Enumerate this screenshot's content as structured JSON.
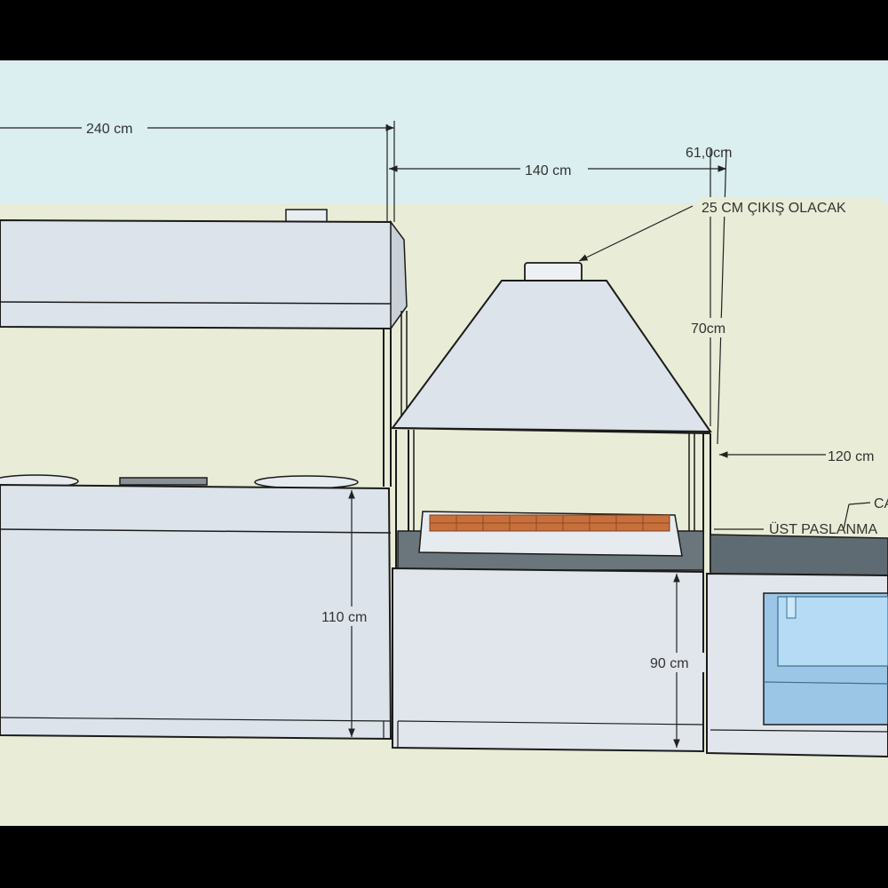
{
  "dimensions": {
    "hood_width": "240 cm",
    "grill_width": "140 cm",
    "gap": "61,0cm",
    "chimney_note": "25 CM ÇIKIŞ OLACAK",
    "hood_height": "70cm",
    "sink_width": "120 cm",
    "counter_note_1": "CA",
    "counter_note_2": "ÜST PASLANMA",
    "stove_height": "110 cm",
    "grill_height": "90 cm"
  },
  "colors": {
    "sky": "#dbeef0",
    "ground": "#e9ecd6",
    "panel": "#dde3ea",
    "panel_light": "#e6ebf0",
    "edge": "#1b1b1b",
    "brick": "#c8703c",
    "sink": "#a9d2ef",
    "counter": "#5f6b72"
  }
}
